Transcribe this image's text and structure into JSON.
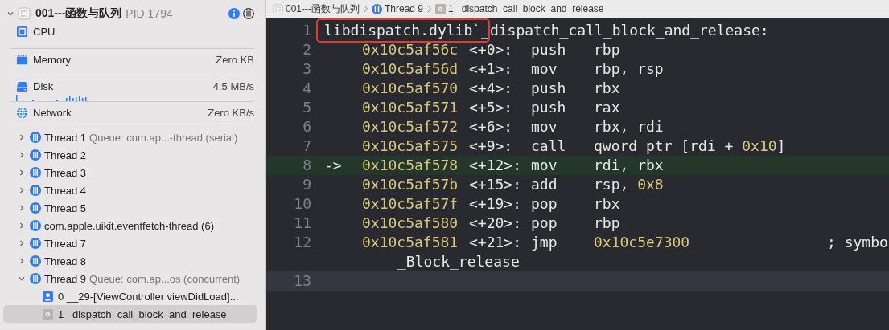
{
  "breadcrumb": [
    {
      "kind": "app",
      "label": "001---函数与队列"
    },
    {
      "kind": "thread",
      "label": "Thread 9"
    },
    {
      "kind": "frame",
      "label": "1 _dispatch_call_block_and_release"
    }
  ],
  "process": {
    "name": "001---函数与队列",
    "pid": "PID 1794",
    "expanded": true
  },
  "gauges": [
    {
      "kind": "cpu",
      "label": "CPU"
    },
    {
      "kind": "memory",
      "label": "Memory",
      "value": "Zero KB"
    },
    {
      "kind": "disk",
      "label": "Disk",
      "value": "4.5 MB/s"
    },
    {
      "kind": "network",
      "label": "Network",
      "value": "Zero KB/s"
    }
  ],
  "threads": [
    {
      "name": "Thread 1",
      "queue": "Queue: com.ap...-thread (serial)",
      "expanded": false
    },
    {
      "name": "Thread 2",
      "expanded": false
    },
    {
      "name": "Thread 3",
      "expanded": false
    },
    {
      "name": "Thread 4",
      "expanded": false
    },
    {
      "name": "Thread 5",
      "expanded": false
    },
    {
      "name": "com.apple.uikit.eventfetch-thread (6)",
      "expanded": false
    },
    {
      "name": "Thread 7",
      "expanded": false
    },
    {
      "name": "Thread 8",
      "expanded": false
    },
    {
      "name": "Thread 9",
      "queue": "Queue: com.ap...os (concurrent)",
      "expanded": true,
      "children": [
        {
          "kind": "user",
          "label": "0 __29-[ViewController viewDidLoad]...",
          "selected": false
        },
        {
          "kind": "library",
          "label": "1 _dispatch_call_block_and_release",
          "selected": true
        }
      ]
    }
  ],
  "disassembly": {
    "header": {
      "number": "1",
      "module": "libdispatch.dylib`",
      "symbol": "_dispatch_call_block_and_release:",
      "boxed": true
    },
    "lines": [
      {
        "number": "2",
        "address": "0x10c5af56c",
        "offset": "<+0>:",
        "mnemonic": "push",
        "operands": [
          {
            "kind": "text",
            "text": "rbp"
          }
        ],
        "executing": false
      },
      {
        "number": "3",
        "address": "0x10c5af56d",
        "offset": "<+1>:",
        "mnemonic": "mov",
        "operands": [
          {
            "kind": "text",
            "text": "rbp, rsp"
          }
        ],
        "executing": false
      },
      {
        "number": "4",
        "address": "0x10c5af570",
        "offset": "<+4>:",
        "mnemonic": "push",
        "operands": [
          {
            "kind": "text",
            "text": "rbx"
          }
        ],
        "executing": false
      },
      {
        "number": "5",
        "address": "0x10c5af571",
        "offset": "<+5>:",
        "mnemonic": "push",
        "operands": [
          {
            "kind": "text",
            "text": "rax"
          }
        ],
        "executing": false
      },
      {
        "number": "6",
        "address": "0x10c5af572",
        "offset": "<+6>:",
        "mnemonic": "mov",
        "operands": [
          {
            "kind": "text",
            "text": "rbx, rdi"
          }
        ],
        "executing": false
      },
      {
        "number": "7",
        "address": "0x10c5af575",
        "offset": "<+9>:",
        "mnemonic": "call",
        "operands": [
          {
            "kind": "text",
            "text": "qword ptr [rdi + "
          },
          {
            "kind": "number",
            "text": "0x10"
          },
          {
            "kind": "text",
            "text": "]"
          }
        ],
        "executing": false
      },
      {
        "number": "8",
        "marker": "->",
        "address": "0x10c5af578",
        "offset": "<+12>:",
        "mnemonic": "mov",
        "operands": [
          {
            "kind": "text",
            "text": "rdi, rbx"
          }
        ],
        "executing": true
      },
      {
        "number": "9",
        "address": "0x10c5af57b",
        "offset": "<+15>:",
        "mnemonic": "add",
        "operands": [
          {
            "kind": "text",
            "text": "rsp, "
          },
          {
            "kind": "number",
            "text": "0x8"
          }
        ],
        "executing": false
      },
      {
        "number": "10",
        "address": "0x10c5af57f",
        "offset": "<+19>:",
        "mnemonic": "pop",
        "operands": [
          {
            "kind": "text",
            "text": "rbx"
          }
        ],
        "executing": false
      },
      {
        "number": "11",
        "address": "0x10c5af580",
        "offset": "<+20>:",
        "mnemonic": "pop",
        "operands": [
          {
            "kind": "text",
            "text": "rbp"
          }
        ],
        "executing": false
      },
      {
        "number": "12",
        "address": "0x10c5af581",
        "offset": "<+21>:",
        "mnemonic": "jmp",
        "operands": [
          {
            "kind": "number",
            "text": "0x10c5e7300"
          }
        ],
        "comment": "; symbo",
        "continuation": "_Block_release",
        "executing": false
      }
    ],
    "end_line": {
      "number": "13",
      "current": true
    }
  }
}
